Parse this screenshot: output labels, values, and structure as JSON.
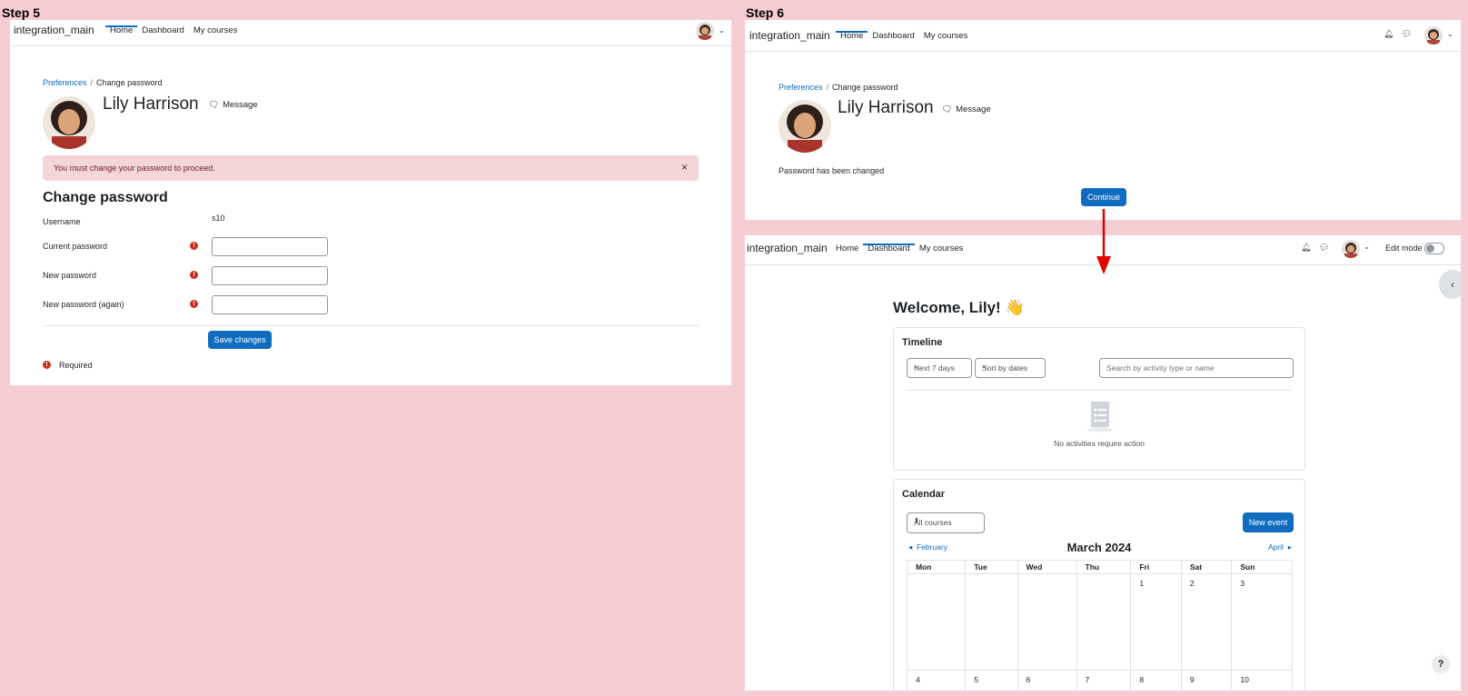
{
  "step5": {
    "label": "Step 5",
    "nav": {
      "brand": "integration_main",
      "links": [
        "Home",
        "Dashboard",
        "My courses"
      ]
    },
    "breadcrumb": {
      "parent": "Preferences",
      "current": "Change password"
    },
    "user": {
      "name": "Lily Harrison",
      "message": "Message"
    },
    "alert": {
      "text": "You must change your password to proceed.",
      "close": "×"
    },
    "form": {
      "title": "Change password",
      "username_label": "Username",
      "username_value": "s10",
      "current_label": "Current password",
      "new_label": "New password",
      "again_label": "New password (again)",
      "save": "Save changes",
      "required": "Required"
    }
  },
  "step6": {
    "label": "Step 6",
    "nav": {
      "brand": "integration_main",
      "links": [
        "Home",
        "Dashboard",
        "My courses"
      ]
    },
    "breadcrumb": {
      "parent": "Preferences",
      "current": "Change password"
    },
    "user": {
      "name": "Lily Harrison",
      "message": "Message"
    },
    "notice": "Password has been changed",
    "continue": "Continue"
  },
  "dashboard": {
    "nav": {
      "brand": "integration_main",
      "links": [
        "Home",
        "Dashboard",
        "My courses"
      ],
      "edit_mode": "Edit mode"
    },
    "welcome": "Welcome, Lily! 👋",
    "timeline": {
      "title": "Timeline",
      "filter_days": "Next 7 days",
      "sort": "Sort by dates",
      "search_placeholder": "Search by activity type or name",
      "empty": "No activities require action"
    },
    "calendar": {
      "title": "Calendar",
      "course_filter": "All courses",
      "new_event": "New event",
      "prev": "February",
      "month": "March 2024",
      "next": "April",
      "days": [
        "Mon",
        "Tue",
        "Wed",
        "Thu",
        "Fri",
        "Sat",
        "Sun"
      ],
      "week1": [
        "",
        "",
        "",
        "",
        "1",
        "2",
        "3"
      ],
      "week2": [
        "4",
        "5",
        "6",
        "7",
        "8",
        "9",
        "10"
      ]
    },
    "help": "?"
  },
  "colors": {
    "accent": "#0f6cbf",
    "background": "#f6cdd3",
    "alert": "#f4d6d9",
    "arrow": "#e00000"
  }
}
